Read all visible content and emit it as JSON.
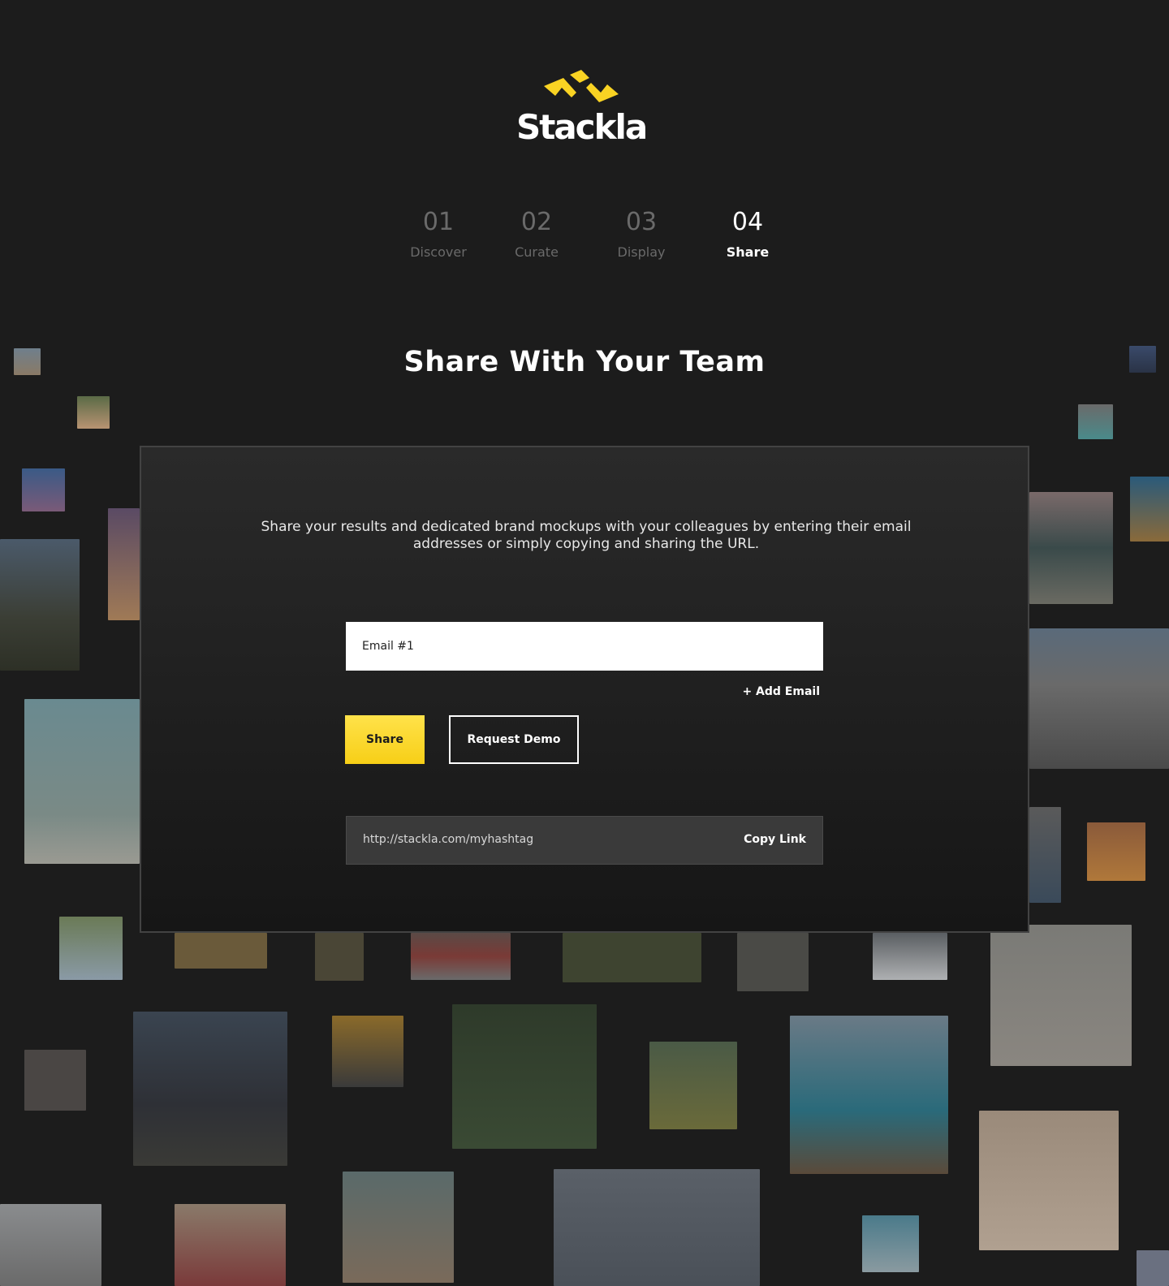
{
  "brand": {
    "name": "Stackla",
    "accent": "#f9d323"
  },
  "steps": [
    {
      "num": "01",
      "label": "Discover"
    },
    {
      "num": "02",
      "label": "Curate"
    },
    {
      "num": "03",
      "label": "Display"
    },
    {
      "num": "04",
      "label": "Share"
    }
  ],
  "active_step": "04",
  "hero": {
    "title": "Share With Your Team"
  },
  "panel": {
    "description": "Share your results and dedicated brand mockups with your colleagues by entering their email addresses or simply copying and sharing the URL.",
    "email_placeholder": "Email #1",
    "add_email_label": "+ Add Email",
    "share_label": "Share",
    "demo_label": "Request Demo",
    "share_url": "http://stackla.com/myhashtag",
    "copy_label": "Copy Link"
  }
}
